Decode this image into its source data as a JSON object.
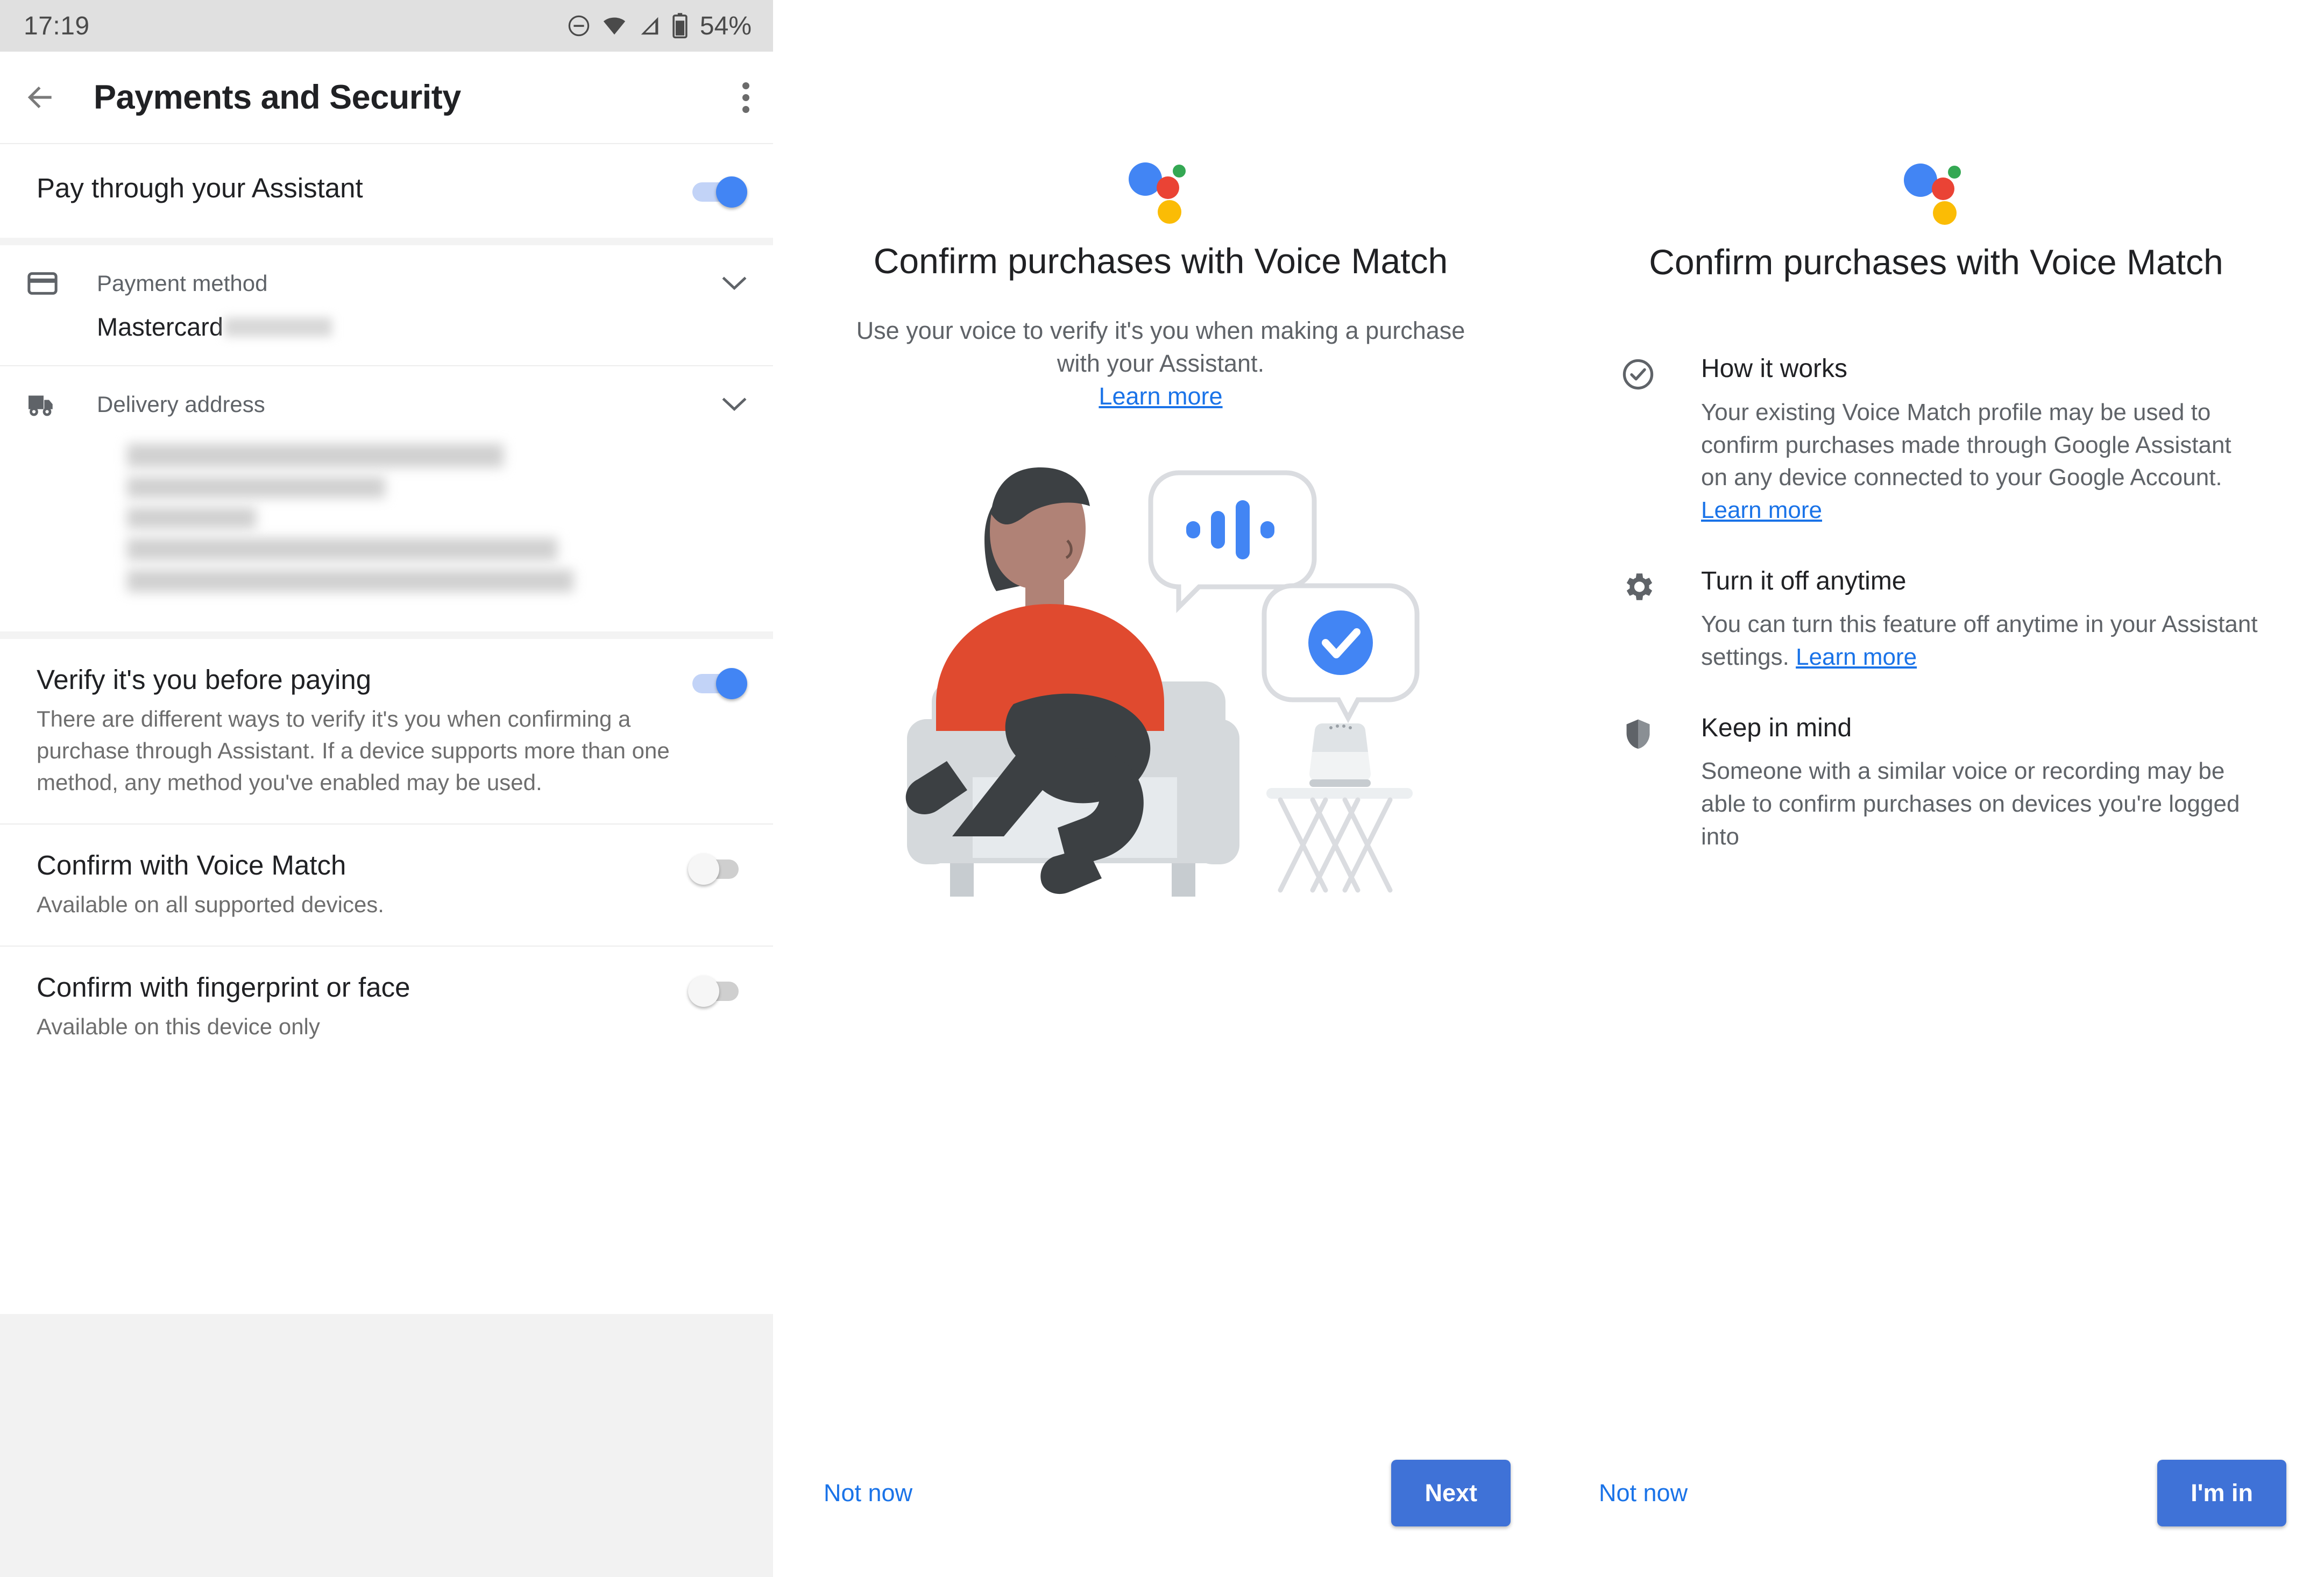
{
  "statusbar": {
    "time": "17:19",
    "battery_percent": "54%",
    "icons": [
      "do-not-disturb-icon",
      "wifi-icon",
      "cellular-signal-icon",
      "battery-icon"
    ]
  },
  "appbar": {
    "title": "Payments and Security",
    "back_icon": "back-arrow-icon",
    "overflow_icon": "more-vert-icon"
  },
  "settings": {
    "pay_through_assistant": {
      "title": "Pay through your Assistant",
      "toggle_state": "on"
    },
    "payment_method": {
      "label": "Payment method",
      "icon": "credit-card-icon",
      "chevron": "chevron-down-icon",
      "value": "Mastercard",
      "value_redacted": true
    },
    "delivery_address": {
      "label": "Delivery address",
      "icon": "truck-icon",
      "chevron": "chevron-down-icon",
      "value_redacted": true
    },
    "verify_before_paying": {
      "title": "Verify it's you before paying",
      "description": "There are different ways to verify it's you when confirming a purchase through Assistant. If a device supports more than one method, any method you've enabled may be used.",
      "toggle_state": "on"
    },
    "confirm_voice_match": {
      "title": "Confirm with Voice Match",
      "description": "Available on all supported devices.",
      "toggle_state": "off"
    },
    "confirm_fingerprint_face": {
      "title": "Confirm with fingerprint or face",
      "description": "Available on this device only",
      "toggle_state": "off"
    }
  },
  "onboarding_intro": {
    "logo": "google-assistant-logo",
    "title": "Confirm purchases with Voice Match",
    "description": "Use your voice to verify it's you when making a purchase with your Assistant.",
    "learn_more": "Learn more",
    "illustration": "person-in-armchair-with-smart-speaker-illustration",
    "actions": {
      "secondary": "Not now",
      "primary": "Next"
    }
  },
  "onboarding_details": {
    "logo": "google-assistant-logo",
    "title": "Confirm purchases with Voice Match",
    "features": [
      {
        "icon": "check-circle-icon",
        "heading": "How it works",
        "body": "Your existing Voice Match profile may be used to confirm purchases made through Google Assistant on any device connected to your Google Account.",
        "link": "Learn more",
        "link_inline": false
      },
      {
        "icon": "gear-icon",
        "heading": "Turn it off anytime",
        "body": "You can turn this feature off anytime in your Assistant settings.",
        "link": "Learn more",
        "link_inline": true
      },
      {
        "icon": "shield-icon",
        "heading": "Keep in mind",
        "body": "Someone with a similar voice or recording may be able to confirm purchases on devices you're logged into",
        "link": "",
        "link_inline": false
      }
    ],
    "actions": {
      "secondary": "Not now",
      "primary": "I'm in"
    }
  },
  "colors": {
    "accent_blue": "#4285f4",
    "link_blue": "#1a73e8",
    "button_blue": "#3f72d7",
    "assistant_blue": "#4285f4",
    "assistant_red": "#ea4335",
    "assistant_yellow": "#fbbc05",
    "assistant_green": "#34a853",
    "statusbar_grey": "#e0e0e0",
    "footer_grey": "#f2f2f2",
    "illustration_red": "#e04a2f",
    "illustration_dark": "#3c4043",
    "illustration_skin": "#b08276",
    "illustration_grey": "#d5d9dc"
  }
}
